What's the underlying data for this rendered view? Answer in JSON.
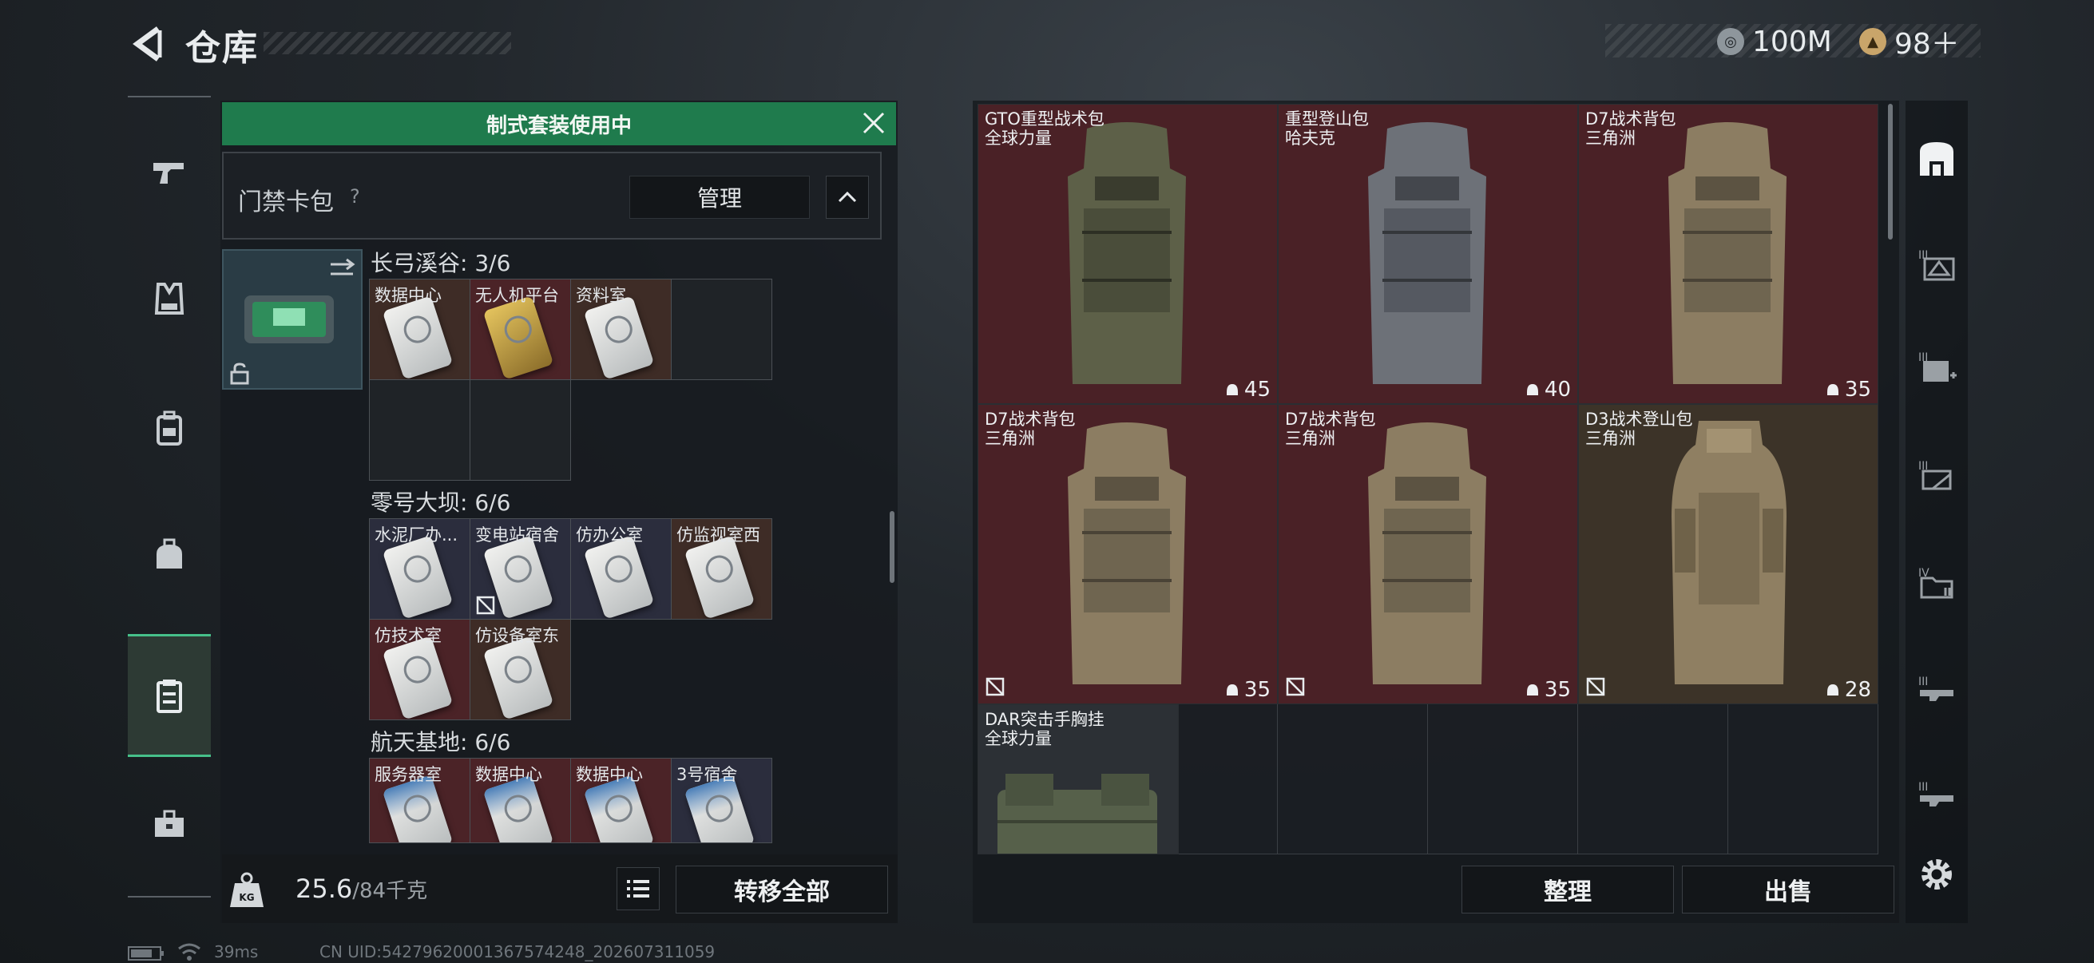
{
  "header": {
    "title": "仓库",
    "currency1": "100M",
    "currency2": "98＋"
  },
  "banner": {
    "text": "制式套装使用中"
  },
  "key_case": {
    "label": "门禁卡包",
    "help": "?",
    "manage": "管理",
    "sections": [
      {
        "title": "长弓溪谷: 3/6",
        "cards": [
          {
            "name": "数据中心",
            "color": "brown",
            "card": "white"
          },
          {
            "name": "无人机平台",
            "color": "red",
            "card": "gold"
          },
          {
            "name": "资料室",
            "color": "brown",
            "card": "white"
          },
          {
            "name": "",
            "color": "blank",
            "card": "none"
          },
          {
            "name": "",
            "color": "blank",
            "card": "none"
          },
          {
            "name": "",
            "color": "blank",
            "card": "none"
          }
        ]
      },
      {
        "title": "零号大坝: 6/6",
        "cards": [
          {
            "name": "水泥厂办...",
            "color": "navy",
            "card": "white"
          },
          {
            "name": "变电站宿舍",
            "color": "navy",
            "card": "white",
            "uninsured": true
          },
          {
            "name": "仿办公室",
            "color": "navy",
            "card": "white"
          },
          {
            "name": "仿监视室西",
            "color": "brown",
            "card": "white"
          },
          {
            "name": "仿技术室",
            "color": "red",
            "card": "white"
          },
          {
            "name": "仿设备室东",
            "color": "brown",
            "card": "white"
          }
        ]
      },
      {
        "title": "航天基地: 6/6",
        "cards": [
          {
            "name": "服务器室",
            "color": "red",
            "card": "blue"
          },
          {
            "name": "数据中心",
            "color": "red",
            "card": "blue"
          },
          {
            "name": "数据中心",
            "color": "red",
            "card": "blue"
          },
          {
            "name": "3号宿舍",
            "color": "navy",
            "card": "blue"
          }
        ]
      }
    ]
  },
  "footer": {
    "weight_current": "25.6",
    "weight_max": "/84千克",
    "transfer_all": "转移全部",
    "tidy": "整理",
    "sell": "出售"
  },
  "items": [
    {
      "line1": "GTO重型战术包",
      "line2": "全球力量",
      "count": "45",
      "color": "red",
      "pack": "#5d6048",
      "uninsured": false
    },
    {
      "line1": "重型登山包",
      "line2": "哈夫克",
      "count": "40",
      "color": "red",
      "pack": "#6d7178",
      "uninsured": false
    },
    {
      "line1": "D7战术背包",
      "line2": "三角洲",
      "count": "35",
      "color": "red",
      "pack": "#8c7d62",
      "uninsured": false
    },
    {
      "line1": "D7战术背包",
      "line2": "三角洲",
      "count": "35",
      "color": "red",
      "pack": "#8c7d62",
      "uninsured": true
    },
    {
      "line1": "D7战术背包",
      "line2": "三角洲",
      "count": "35",
      "color": "red",
      "pack": "#8c7d62",
      "uninsured": true
    },
    {
      "line1": "D3战术登山包",
      "line2": "三角洲",
      "count": "28",
      "color": "tan",
      "pack": "#8f7f62",
      "uninsured": true
    },
    {
      "line1": "DAR突击手胸挂",
      "line2": "全球力量",
      "count": "",
      "color": "grey",
      "pack": "#56604a",
      "uninsured": false
    }
  ],
  "status": {
    "ping": "39ms",
    "uid": "CN UID:5427962000136757424​8_202607311059"
  }
}
